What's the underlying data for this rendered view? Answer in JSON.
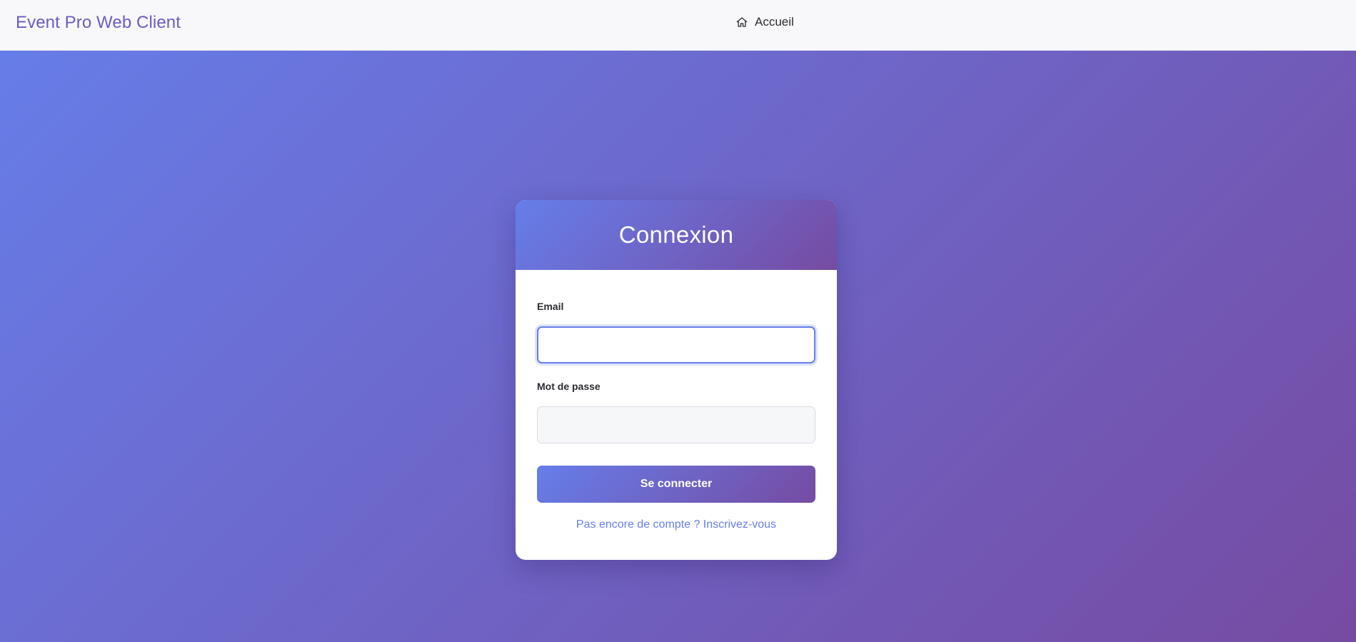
{
  "navbar": {
    "brand": "Event Pro Web Client",
    "home_icon": "home-icon",
    "home_label": "Accueil"
  },
  "login": {
    "title": "Connexion",
    "email_label": "Email",
    "email_value": "",
    "password_label": "Mot de passe",
    "password_value": "",
    "submit_label": "Se connecter",
    "register_link": "Pas encore de compte ? Inscrivez-vous"
  },
  "colors": {
    "gradient_start": "#667eea",
    "gradient_end": "#764ba2",
    "brand_text": "#6c5bc4",
    "link": "#667eea"
  }
}
